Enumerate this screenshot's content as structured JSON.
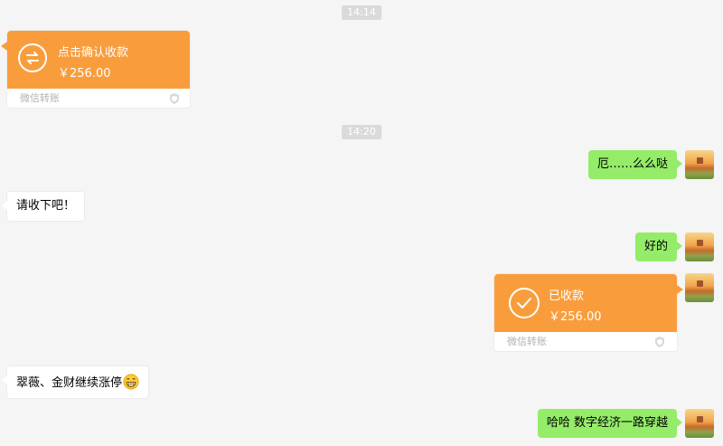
{
  "timestamps": [
    "14:14",
    "14:20"
  ],
  "transfers": [
    {
      "title": "点击确认收款",
      "amount": "￥256.00",
      "footer": "微信转账",
      "icon": "transfer-arrows-icon"
    },
    {
      "title": "已收款",
      "amount": "￥256.00",
      "footer": "微信转账",
      "icon": "checkmark-icon"
    }
  ],
  "messages": [
    {
      "text": "厄……么么哒"
    },
    {
      "text": "请收下吧！"
    },
    {
      "text": "好的"
    },
    {
      "text": "翠薇、金财继续涨停"
    },
    {
      "text": "哈哈 数字经济一路穿越"
    }
  ],
  "colors": {
    "transfer_orange": "#f99d3c",
    "sent_bubble": "#95ec69",
    "received_bubble": "#ffffff",
    "background": "#f5f5f5"
  }
}
